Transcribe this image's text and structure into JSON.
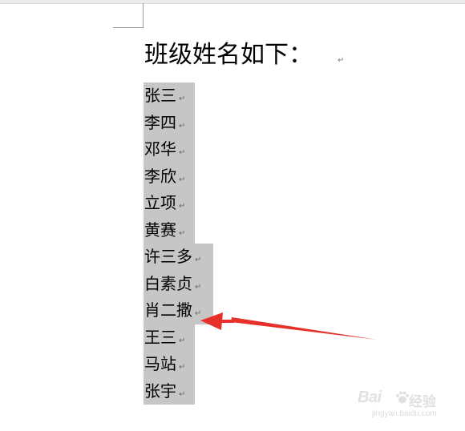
{
  "document": {
    "heading": "班级姓名如下：",
    "paragraph_mark": "↵",
    "names": [
      {
        "name": "张三"
      },
      {
        "name": "李四"
      },
      {
        "name": "邓华"
      },
      {
        "name": "李欣"
      },
      {
        "name": "立项"
      },
      {
        "name": "黄赛"
      },
      {
        "name": "许三多"
      },
      {
        "name": "白素贞"
      },
      {
        "name": "肖二撒"
      },
      {
        "name": "王三"
      },
      {
        "name": "马站"
      },
      {
        "name": "张宇"
      }
    ]
  },
  "colors": {
    "selection": "#c6c6c6",
    "arrow": "#e8302a"
  },
  "watermark": {
    "brand": "Bai",
    "brand_cn": "经验",
    "url": "jingyan.baidu.com"
  }
}
